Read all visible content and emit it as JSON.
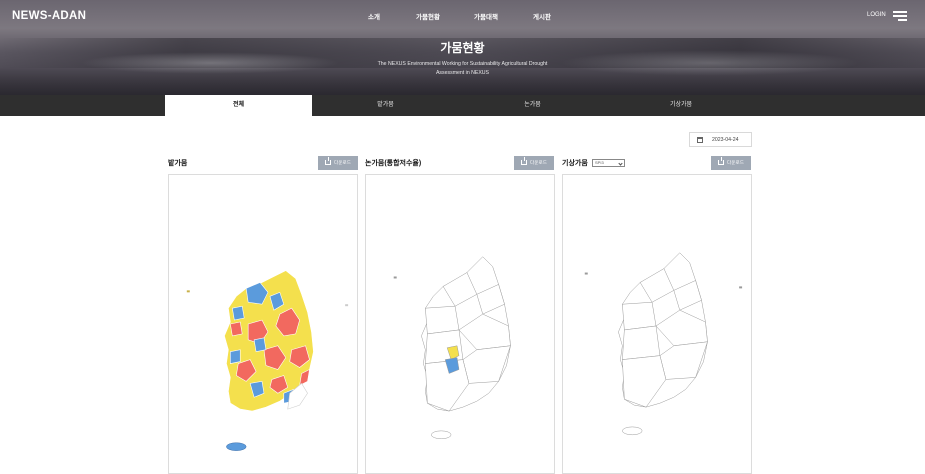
{
  "header": {
    "logo": "NEWS-ADAN",
    "nav": [
      {
        "label": "소개"
      },
      {
        "label": "가뭄현황"
      },
      {
        "label": "가뭄대책"
      },
      {
        "label": "게시판"
      }
    ],
    "login": "LOGIN"
  },
  "hero": {
    "title": "가뭄현황",
    "subtitle_line1": "The NEXUS Environmental Working for Sustainability Agricultural Drought",
    "subtitle_line2": "Assessment in NEXUS"
  },
  "tabs": [
    {
      "label": "전체",
      "active": true
    },
    {
      "label": "밭가뭄",
      "active": false
    },
    {
      "label": "논가뭄",
      "active": false
    },
    {
      "label": "기상가뭄",
      "active": false
    }
  ],
  "date_filter": {
    "value": "2023-04-24",
    "icon": "calendar-icon"
  },
  "panels": [
    {
      "title": "밭가뭄",
      "download_label": "다운로드"
    },
    {
      "title": "논가뭄(통합저수율)",
      "download_label": "다운로드"
    },
    {
      "title": "기상가뭄",
      "select_value": "SPI3",
      "download_label": "다운로드"
    }
  ],
  "colors": {
    "drought_red": "#f2695f",
    "drought_yellow": "#f4e04d",
    "drought_blue": "#5b9bdc",
    "download_button": "#9fa8b4",
    "tab_bar": "#2f2f2f"
  }
}
